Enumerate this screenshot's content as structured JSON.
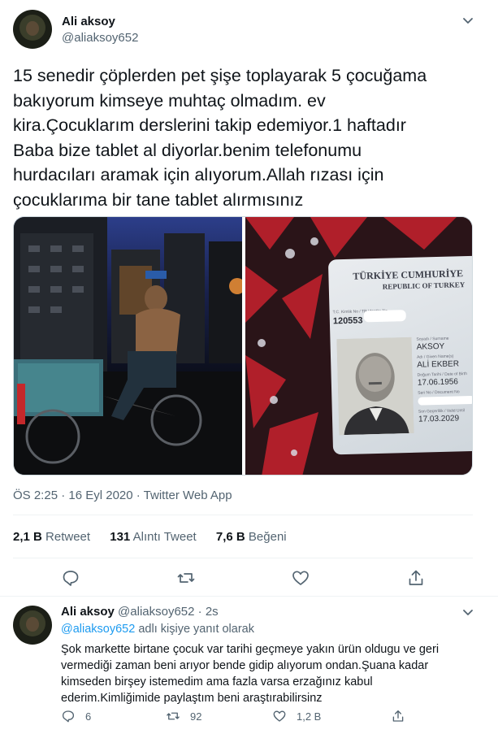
{
  "tweet": {
    "author_name": "Ali aksoy",
    "author_handle": "@aliaksoy652",
    "text": "15 senedir çöplerden pet şişe toplayarak 5 çocuğama\nbakıyorum kimseye muhtaç olmadım. ev\nkira.Çocuklarım derslerini takip edemiyor.1 haftadır\nBaba bize tablet al diyorlar.benim telefonumu\nhurdacıları aramak için alıyorum.Allah rızası için\nçocuklarıma bir tane tablet alırmısınız",
    "timestamp": "ÖS 2:25 · 16 Eyl 2020 · Twitter Web App",
    "stats": [
      {
        "value": "2,1 B",
        "label": "Retweet"
      },
      {
        "value": "131",
        "label": "Alıntı Tweet"
      },
      {
        "value": "7,6 B",
        "label": "Beğeni"
      }
    ],
    "id_card": {
      "title": "TÜRKİYE CUMHURİYE",
      "subtitle": "REPUBLIC OF TURKEY",
      "id_label": "T.C. Kimlik No / TR Identity No",
      "id_number": "120553",
      "surname_label": "Soyadı / Surname",
      "surname": "AKSOY",
      "given_label": "Adı / Given Name(s)",
      "given_name": "ALİ EKBER",
      "dob_label": "Doğum Tarihi / Date of Birth",
      "dob": "17.06.1956",
      "docno_label": "Seri No / Document No",
      "expiry_label": "Son Geçerlilik / Valid Until",
      "expiry": "17.03.2029"
    }
  },
  "reply": {
    "author_name": "Ali aksoy",
    "author_handle": "@aliaksoy652",
    "age": "· 2s",
    "reply_to_handle": "@aliaksoy652",
    "reply_to_suffix": " adlı kişiye yanıt olarak",
    "text": "Şok markette birtane çocuk var tarihi geçmeye yakın ürün oldugu ve geri\nvermediği zaman beni arıyor bende gidip alıyorum ondan.Şuana kadar\nkimseden birşey istemedim ama fazla varsa erzağınız kabul\nederim.Kimliğimide paylaştım beni araştırabilirsinz",
    "counts": {
      "replies": "6",
      "retweets": "92",
      "likes": "1,2 B"
    }
  },
  "colors": {
    "link": "#1d9bf0",
    "secondary": "#536471",
    "text": "#0f1419"
  },
  "icons": [
    "chevron-down-icon",
    "reply-icon",
    "retweet-icon",
    "like-icon",
    "share-icon"
  ]
}
